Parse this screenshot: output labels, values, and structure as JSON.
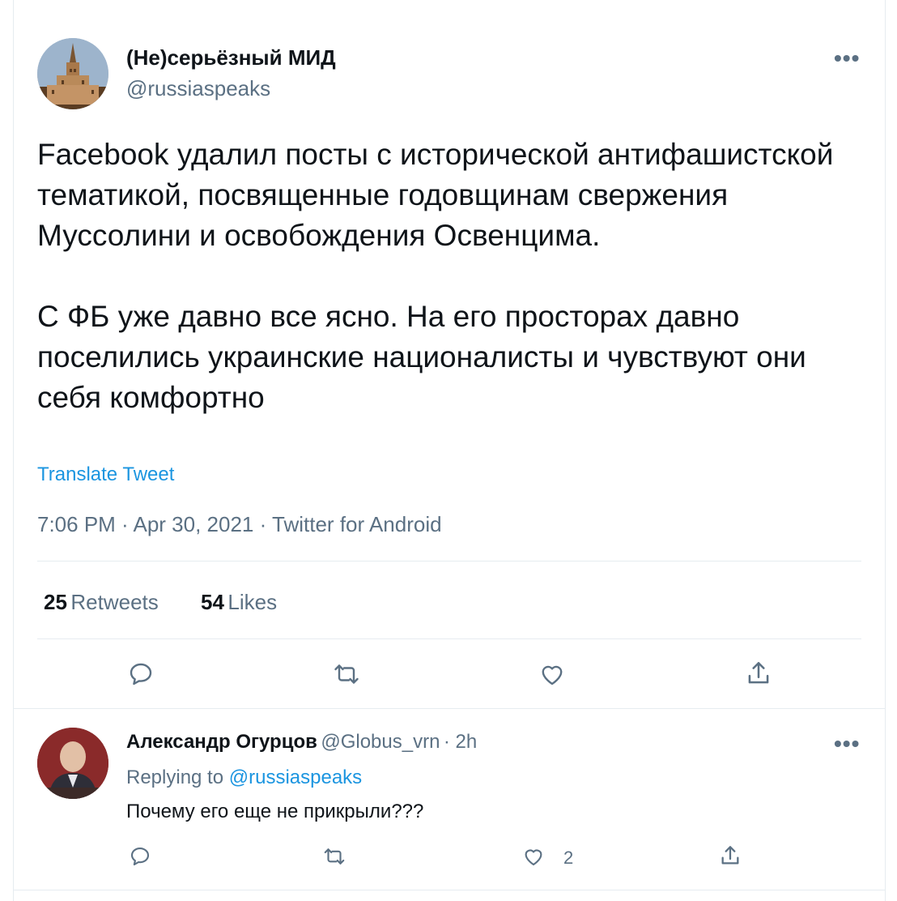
{
  "tweet": {
    "author_name": "(Не)серьёзный МИД",
    "author_handle": "@russiaspeaks",
    "more_label": "•••",
    "text": "Facebook удалил посты с исторической антифашистской тематикой, посвященные годовщинам свержения Муссолини и освобождения Освенцима.\n\nС ФБ уже давно все ясно. На его просторах давно поселились украинские националисты и чувствуют они себя комфортно",
    "translate_label": "Translate Tweet",
    "meta": "7:06 PM · Apr 30, 2021 · Twitter for Android",
    "retweets_count": "25",
    "retweets_label": "Retweets",
    "likes_count": "54",
    "likes_label": "Likes"
  },
  "reply": {
    "author_name": "Александр Огурцов",
    "author_handle": "@Globus_vrn",
    "time": "· 2h",
    "more_label": "•••",
    "replying_prefix": "Replying to",
    "replying_handle": "@russiaspeaks",
    "text": "Почему его еще не прикрыли???",
    "like_count": "2"
  },
  "icons": {
    "reply": "reply-icon",
    "retweet": "retweet-icon",
    "like": "heart-icon",
    "share": "share-icon"
  },
  "colors": {
    "link": "#1b95e0",
    "muted": "#5b7083",
    "text": "#0f1419",
    "border": "#e6ecf0"
  }
}
